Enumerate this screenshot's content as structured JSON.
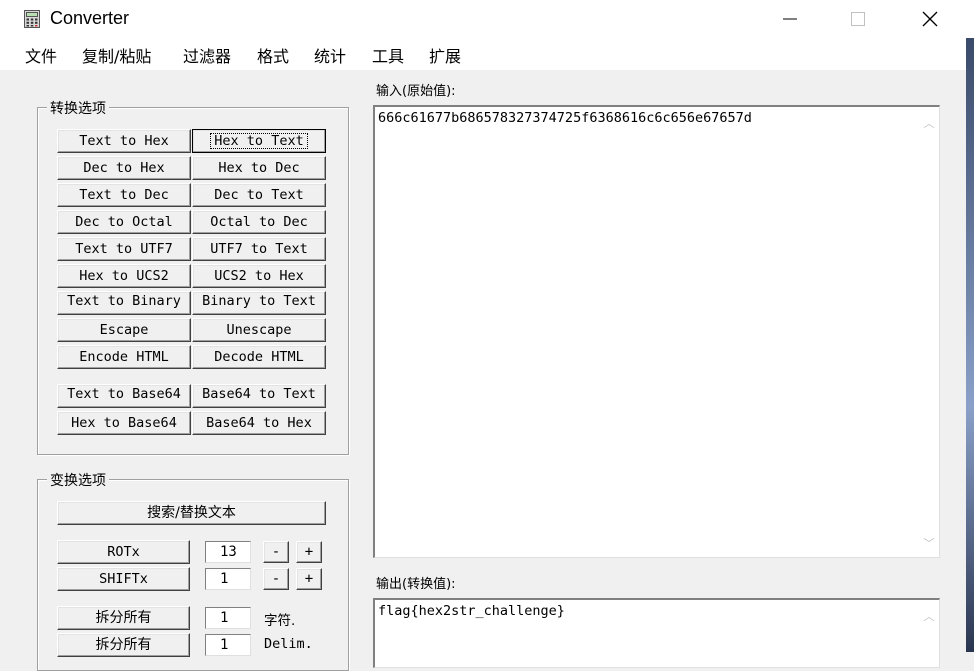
{
  "window": {
    "title": "Converter",
    "icon": "calculator-icon"
  },
  "menu": [
    "文件",
    "复制/粘贴",
    "过滤器",
    "格式",
    "统计",
    "工具",
    "扩展"
  ],
  "convert_group": {
    "label": "转换选项",
    "buttons": [
      [
        "Text to Hex",
        "Hex to Text"
      ],
      [
        "Dec to Hex",
        "Hex to Dec"
      ],
      [
        "Text to Dec",
        "Dec to Text"
      ],
      [
        "Dec to Octal",
        "Octal to Dec"
      ],
      [
        "Text to UTF7",
        "UTF7 to Text"
      ],
      [
        "Hex to UCS2",
        "UCS2 to Hex"
      ],
      [
        "Text to Binary",
        "Binary to Text"
      ],
      [
        "Escape",
        "Unescape"
      ],
      [
        "Encode HTML",
        "Decode HTML"
      ],
      [
        "Text to Base64",
        "Base64 to Text"
      ],
      [
        "Hex to Base64",
        "Base64 to Hex"
      ]
    ]
  },
  "transform_group": {
    "label": "变换选项",
    "search_replace": "搜索/替换文本",
    "rot_label": "ROTx",
    "rot_value": "13",
    "shift_label": "SHIFTx",
    "shift_value": "1",
    "minus": "-",
    "plus": "+",
    "split1_label": "拆分所有",
    "split1_value": "1",
    "split1_unit": "字符.",
    "split2_label": "拆分所有",
    "split2_value": "1",
    "split2_unit": "Delim."
  },
  "input": {
    "label": "输入(原始值):",
    "value": "666c61677b686578327374725f6368616c6c656e67657d"
  },
  "output": {
    "label": "输出(转换值):",
    "value": "flag{hex2str_challenge}"
  }
}
